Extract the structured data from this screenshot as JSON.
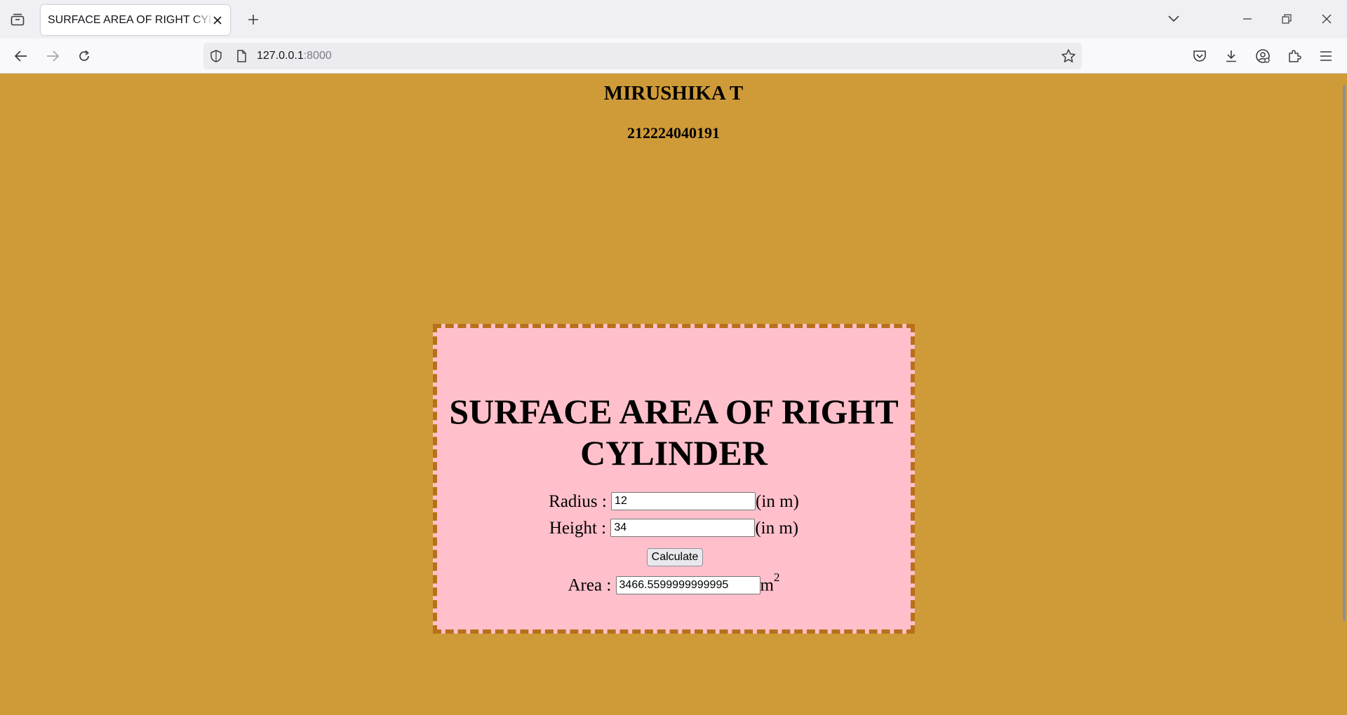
{
  "browser": {
    "tab_title": "SURFACE AREA OF RIGHT CYLINDER",
    "url_host": "127.0.0.1",
    "url_port": ":8000"
  },
  "page": {
    "author": "MIRUSHIKA T",
    "reg_no": "212224040191",
    "title": "SURFACE AREA OF RIGHT CYLINDER",
    "radius_label": "Radius :",
    "radius_value": "12",
    "radius_unit": "(in m)",
    "height_label": "Height :",
    "height_value": "34",
    "height_unit": "(in m)",
    "calculate_label": "Calculate",
    "area_label": "Area :",
    "area_value": "3466.5599999999995",
    "area_unit": "m",
    "area_unit_exp": "2"
  },
  "colors": {
    "page_background": "#cf9b39",
    "card_background": "#ffc0cb",
    "card_border": "#b8701b"
  },
  "icons": [
    "tab-list-icon",
    "close-icon",
    "plus-icon",
    "chevron-down-icon",
    "minimize-icon",
    "restore-icon",
    "window-close-icon",
    "back-arrow-icon",
    "forward-arrow-icon",
    "reload-icon",
    "shield-icon",
    "page-icon",
    "star-icon",
    "pocket-icon",
    "download-icon",
    "account-icon",
    "extensions-icon",
    "menu-icon"
  ]
}
